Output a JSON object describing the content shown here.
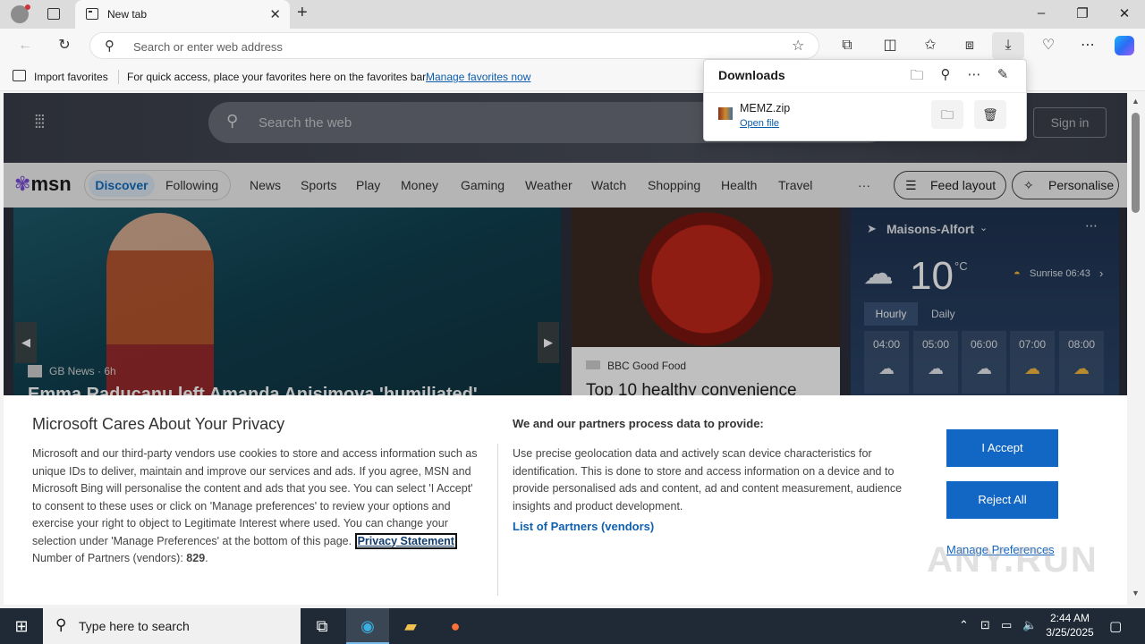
{
  "browser": {
    "tab_title": "New tab",
    "address_placeholder": "Search or enter web address"
  },
  "favorites_bar": {
    "import_label": "Import favorites",
    "message": "For quick access, place your favorites here on the favorites bar.",
    "manage_link": "Manage favorites now"
  },
  "downloads": {
    "title": "Downloads",
    "items": [
      {
        "file_name": "MEMZ.zip",
        "action_label": "Open file"
      }
    ]
  },
  "msn": {
    "search_placeholder": "Search the web",
    "sign_in": "Sign in",
    "logo": "msn",
    "tabs": [
      "Discover",
      "Following"
    ],
    "nav": [
      "News",
      "Sports",
      "Play",
      "Money",
      "Gaming",
      "Weather",
      "Watch",
      "Shopping",
      "Health",
      "Travel"
    ],
    "more": "···",
    "feed_layout": "Feed layout",
    "personalise": "Personalise",
    "hero": {
      "source": "GB News · 6h",
      "headline": "Emma Raducanu left Amanda Anisimova 'humiliated'"
    },
    "food": {
      "source": "BBC Good Food",
      "headline": "Top 10 healthy convenience"
    },
    "weather": {
      "location": "Maisons-Alfort",
      "temperature": "10",
      "unit": "°C",
      "sunrise": "Sunrise 06:43",
      "tabs": [
        "Hourly",
        "Daily"
      ],
      "hours": [
        "04:00",
        "05:00",
        "06:00",
        "07:00",
        "08:00"
      ]
    }
  },
  "privacy": {
    "title": "Microsoft Cares About Your Privacy",
    "body": "Microsoft and our third-party vendors use cookies to store and access information such as unique IDs to deliver, maintain and improve our services and ads. If you agree, MSN and Microsoft Bing will personalise the content and ads that you see. You can select 'I Accept' to consent to these uses or click on 'Manage preferences' to review your options and exercise your right to object to Legitimate Interest where used.  You can change your selection under 'Manage Preferences' at the bottom of this page.",
    "privacy_link": "Privacy Statement",
    "partners_count_label": "Number of Partners (vendors):",
    "partners_count": "829",
    "right_title": "We and our partners process data to provide:",
    "right_body": "Use precise geolocation data and actively scan device characteristics for identification. This is done to store and access information on a device and to provide personalised ads and content, ad and content measurement, audience insights and product development.",
    "partners_link": "List of Partners (vendors)",
    "accept": "I Accept",
    "reject": "Reject All",
    "manage": "Manage Preferences"
  },
  "watermark": "ANY.RUN",
  "taskbar": {
    "search_placeholder": "Type here to search",
    "time": "2:44 AM",
    "date": "3/25/2025"
  }
}
